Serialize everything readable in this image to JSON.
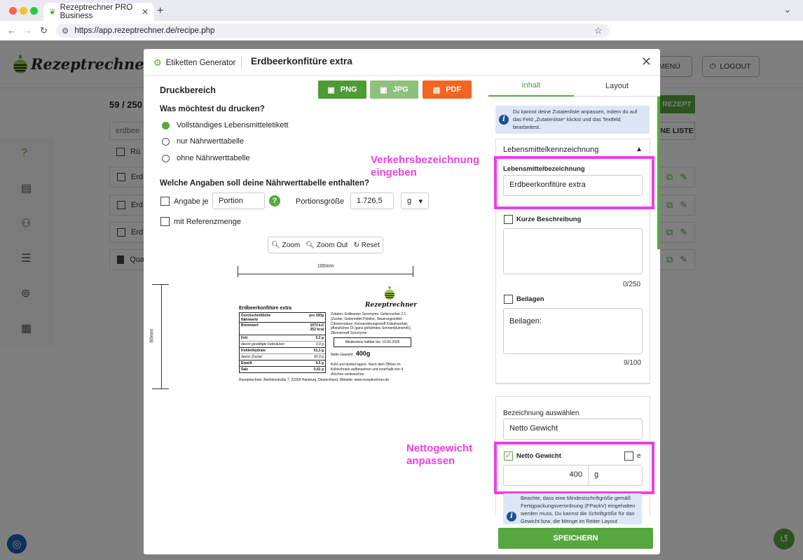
{
  "browser": {
    "tab_title": "Rezeptrechner PRO Business",
    "url": "https://app.rezeptrechner.de/recipe.php"
  },
  "app": {
    "logo_text": "Rezeptrechner",
    "menu_label": "MENÜ",
    "logout_label": "LOGOUT",
    "count_text": "59 / 250",
    "search_value": "erdbee",
    "new_recipe_label": "REZEPT",
    "list_label": "NE LISTE",
    "rows": [
      "Rü",
      "Erd",
      "Erd",
      "Erd",
      "Qua"
    ]
  },
  "modal": {
    "generator_label": "Etiketten Generator",
    "title": "Erdbeerkonfitüre extra",
    "druckbereich": "Druckbereich",
    "buttons": {
      "png": "PNG",
      "jpg": "JPG",
      "pdf": "PDF"
    },
    "question_print": "Was möchtest du drucken?",
    "print_options": [
      "Vollständiges Lebensmitteletikett",
      "nur Nährwerttabelle",
      "ohne Nährwerttabelle"
    ],
    "selected_print_option": 0,
    "question_nutrition": "Welche Angaben soll deine Nährwerttabelle enthalten?",
    "angabe_je_label": "Angabe je",
    "portion_value": "Portion",
    "portion_size_label": "Portionsgröße",
    "portion_size_value": "1.726,5",
    "unit_value": "g",
    "referenzmenge_label": "mit Referenzmenge",
    "zoom": {
      "zoom_in": "Zoom",
      "zoom_out": "Zoom Out",
      "reset": "Reset"
    },
    "preview": {
      "width_label": "100mm",
      "height_label": "60mm",
      "product_name": "Erdbeerkonfitüre extra",
      "logo_text": "Rezeptrechner",
      "nutrition_header_left": "Durchschnittliche Nährwerte",
      "nutrition_header_right": "pro 100g",
      "nutrition_rows": [
        {
          "name": "Brennwert",
          "value": "1073 kJ/ 252 kcal"
        },
        {
          "name": "Fett",
          "value": "0,2 g"
        },
        {
          "name": "davon gesättigte Fettsäuren",
          "value": "0,0 g"
        },
        {
          "name": "Kohlenhydrate",
          "value": "61,1 g"
        },
        {
          "name": "davon Zucker",
          "value": "60,9 g"
        },
        {
          "name": "Eiweiß",
          "value": "0,5 g"
        },
        {
          "name": "Salz",
          "value": "0,41 g"
        }
      ],
      "ingredients": "Zutaten: Erdbeeren Synonyme, Gelierzucker 2:1 - (Zucker, Geliermittel Pektine, Säuerungsmittel Citronensäure, Konservierungsstoff Kaliumsorbat, pflanzliches Öl (ganz gehärtetes Sonnenblumenöl)), Zitronensaft Synonyme",
      "best_before": "Mindestens haltbar bis: 10.06.2026",
      "net_weight_label": "Netto Gewicht:",
      "net_weight_value": "400g",
      "storage": "Kühl und dunkel lagern. Nach dem Öffnen im Kühlschrank aufbewahren und innerhalb von 4 Wochen verbrauchen.",
      "address": "Rezeptrechner, Beirisbostraße 7, 22305 Hamburg, Deutschland, Website: www.rezeptrechner.de"
    },
    "annotations": {
      "verkehr": "Verkehrsbezeichnung eingeben",
      "netto": "Nettogewicht anpassen"
    },
    "panel": {
      "tab_inhalt": "Inhalt",
      "tab_layout": "Layout",
      "info_text": "Du kannst deine Zutatenliste anpassen, indem du auf das Feld „Zutatenliste“ klickst und das Textfeld bearbeitest.",
      "accordion_title": "Lebensmittelkennzeichnung",
      "lebensmittelbezeichnung_label": "Lebensmittelbezeichnung",
      "lebensmittelbezeichnung_value": "Erdbeerkonfitüre extra",
      "kurze_beschreibung_label": "Kurze Beschreibung",
      "kurze_counter": "0/250",
      "beilagen_label": "Beilagen",
      "beilagen_value": "Beilagen:",
      "beilagen_counter": "9/100",
      "bezeichnung_label": "Bezeichnung auswählen",
      "bezeichnung_value": "Netto Gewicht",
      "netto_checkbox_label": "Netto Gewicht",
      "e_label": "e",
      "netto_value": "400",
      "netto_unit": "g",
      "info2_text": "Beachte, dass eine Mindestschriftgröße gemäß Fertigpackungsverordnung (FPackV) eingehalten werden muss. Du kannst die Schriftgröße für das Gewicht bzw. die Menge im Reiter Layout",
      "save_label": "SPEICHERN"
    }
  },
  "colors": {
    "green": "#56a83e",
    "orange": "#f26522",
    "highlight": "#ee3ee8",
    "info_bg": "#dbe7f7"
  }
}
